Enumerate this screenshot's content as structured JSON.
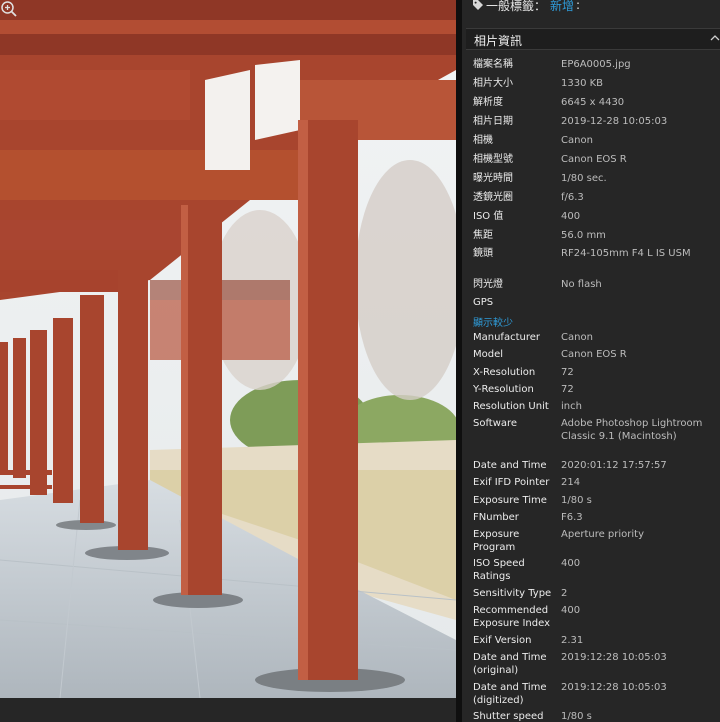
{
  "tags": {
    "label": "一般標籤：",
    "add_link": "新增"
  },
  "section": {
    "title": "相片資訊"
  },
  "primary_info": [
    {
      "label": "檔案名稱",
      "value": "EP6A0005.jpg"
    },
    {
      "label": "相片大小",
      "value": "1330 KB"
    },
    {
      "label": "解析度",
      "value": "6645 x 4430"
    },
    {
      "label": "相片日期",
      "value": "2019-12-28 10:05:03"
    },
    {
      "label": "相機",
      "value": "Canon"
    },
    {
      "label": "相機型號",
      "value": "Canon EOS R"
    },
    {
      "label": "曝光時間",
      "value": "1/80 sec."
    },
    {
      "label": "透鏡光圈",
      "value": "f/6.3"
    },
    {
      "label": "ISO 值",
      "value": "400"
    },
    {
      "label": "焦距",
      "value": "56.0 mm"
    },
    {
      "label": "鏡頭",
      "value": "RF24-105mm F4 L IS USM"
    },
    {
      "label": "閃光燈",
      "value": "No flash"
    },
    {
      "label": "GPS",
      "value": ""
    }
  ],
  "show_less_label": "顯示較少",
  "exif_info": [
    {
      "label": "Manufacturer",
      "value": "Canon"
    },
    {
      "label": "Model",
      "value": "Canon EOS R"
    },
    {
      "label": "X-Resolution",
      "value": "72"
    },
    {
      "label": "Y-Resolution",
      "value": "72"
    },
    {
      "label": "Resolution Unit",
      "value": "inch"
    },
    {
      "label": "Software",
      "value": "Adobe Photoshop Lightroom Classic 9.1 (Macintosh)"
    },
    {
      "label": "Date and Time",
      "value": "2020:01:12 17:57:57"
    },
    {
      "label": "Exif IFD Pointer",
      "value": "214"
    },
    {
      "label": "Exposure Time",
      "value": "1/80 s"
    },
    {
      "label": "FNumber",
      "value": "F6.3"
    },
    {
      "label": "Exposure Program",
      "value": "Aperture priority"
    },
    {
      "label": "ISO Speed Ratings",
      "value": "400"
    },
    {
      "label": "Sensitivity Type",
      "value": "2"
    },
    {
      "label": "Recommended Exposure Index",
      "value": "400"
    },
    {
      "label": "Exif Version",
      "value": "2.31"
    },
    {
      "label": "Date and Time (original)",
      "value": "2019:12:28 10:05:03"
    },
    {
      "label": "Date and Time (digitized)",
      "value": "2019:12:28 10:05:03"
    },
    {
      "label": "Shutter speed",
      "value": "1/80 s"
    }
  ],
  "icons": {
    "tag": "tag-icon",
    "collapse": "chevron-up-icon",
    "zoom": "zoom-in-icon"
  },
  "colors": {
    "link": "#2f9bd8",
    "panel_bg": "#262626",
    "header_bg": "#1e1e1e",
    "pillar": "#a8452e"
  }
}
